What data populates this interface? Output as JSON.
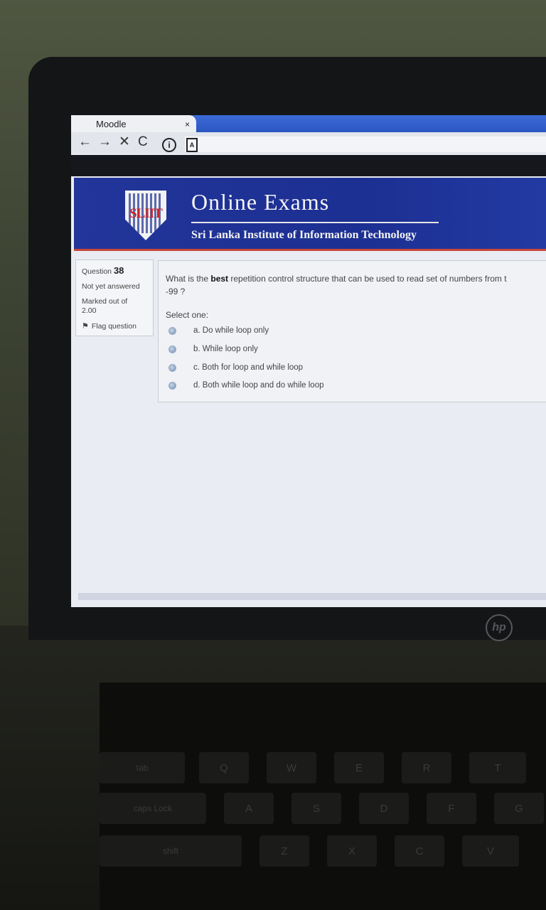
{
  "browser": {
    "tab_title": "Moodle",
    "tab_close": "×",
    "nav": {
      "back": "←",
      "forward": "→",
      "stop": "✕",
      "reload": "C"
    }
  },
  "site": {
    "logo_text": "SLIIT",
    "title": "Online Exams",
    "subtitle": "Sri Lanka Institute of Information Technology"
  },
  "question_info": {
    "question_label": "Question",
    "question_number": "38",
    "status": "Not yet answered",
    "marked_out_of_label": "Marked out of",
    "marked_out_of_value": "2.00",
    "flag_label": "Flag question"
  },
  "question": {
    "text_pre": "What is the ",
    "text_bold": "best",
    "text_post": " repetition control structure that can be used to read set of numbers from t",
    "text_line2": "-99 ?",
    "select_prompt": "Select one:",
    "options": [
      {
        "label": "a. Do while loop only"
      },
      {
        "label": "b. While loop only"
      },
      {
        "label": "c. Both for loop and while loop"
      },
      {
        "label": "d. Both while loop and do while loop"
      }
    ]
  },
  "laptop": {
    "brand": "hp"
  },
  "keyboard": {
    "keys": [
      "Q",
      "W",
      "E",
      "R",
      "T",
      "A",
      "S",
      "D",
      "F",
      "G",
      "Z",
      "X",
      "C",
      "V",
      "tab",
      "caps Lock",
      "shift"
    ]
  },
  "colors": {
    "banner": "#1c2f92",
    "banner_accent": "#c8463a",
    "tab_strip": "#2b56c2"
  }
}
